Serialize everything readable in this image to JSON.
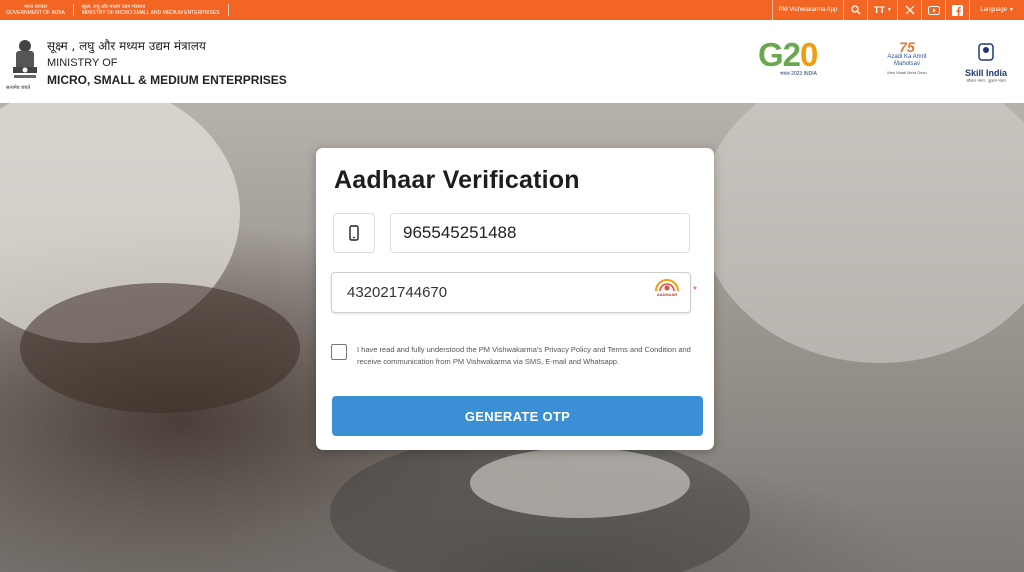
{
  "topbar": {
    "gov_hindi": "भारत सरकार",
    "gov_english": "GOVERNMENT OF INDIA",
    "ministry_hindi": "सूक्ष्म, लघु और मध्यम उद्यम मंत्रालय",
    "ministry_english": "MINISTRY OF MICRO,SMALL AND MEDIUM ENTERPRISES",
    "app_link": "PM Vishwakarma App",
    "text_size_label": "TT",
    "language": "Language"
  },
  "header": {
    "ministry_hindi": "सूक्ष्म , लघु और मध्यम उद्यम मंत्रालय",
    "ministry_line1": "MINISTRY OF",
    "ministry_line2": "MICRO, SMALL & MEDIUM ENTERPRISES",
    "emblem_caption": "सत्यमेव जयते",
    "g20_sub": "भारत 2023 INDIA",
    "azadi_name": "Azadi Ka Amrit Mahotsav",
    "azadi_sub": "Meri Maati Mera Desh",
    "skill_name": "Skill India",
    "skill_tag": "कौशल भारत - कुशल भारत"
  },
  "card": {
    "title": "Aadhaar Verification",
    "mobile_value": "965545251488",
    "aadhaar_value": "432021744670",
    "aadhaar_logo_text": "AADHAAR",
    "consent_text": "I have read and fully understood the PM Vishwakarma's Privacy Policy and Terms and Condition and receive communication from PM Vishwakarma via SMS, E-mail and Whatsapp.",
    "button_label": "GENERATE OTP",
    "required_mark": "*"
  },
  "colors": {
    "topbar": "#f26522",
    "primary_button": "#3b8fd4",
    "required": "#e53935"
  },
  "icons": [
    "search-icon",
    "text-size-icon",
    "x-twitter-icon",
    "youtube-icon",
    "facebook-icon",
    "mobile-phone-icon"
  ]
}
